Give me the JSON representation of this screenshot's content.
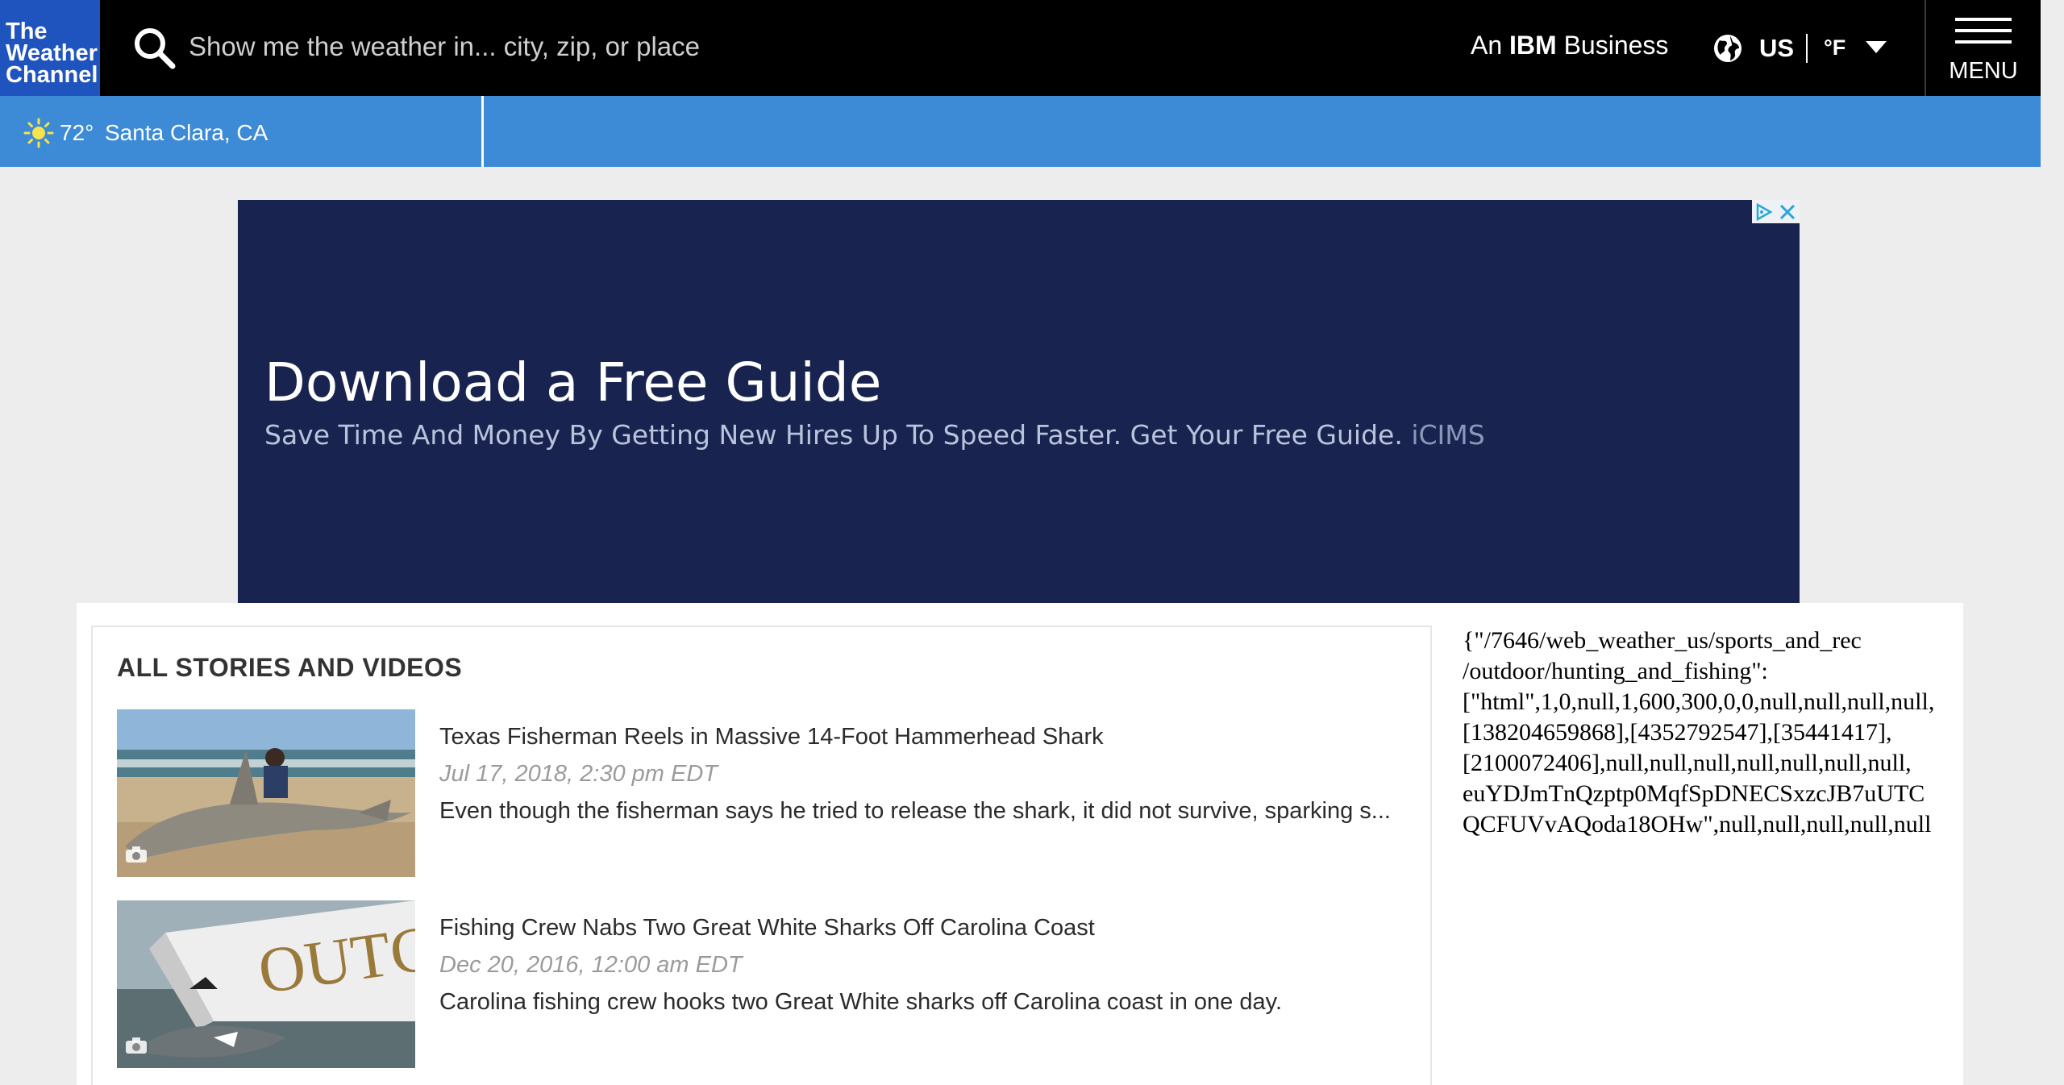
{
  "header": {
    "logo_lines": [
      "The",
      "Weather",
      "Channel"
    ],
    "search_placeholder": "Show me the weather in... city, zip, or place",
    "ibm_prefix": "An",
    "ibm_bold": "IBM",
    "ibm_suffix": "Business",
    "locale": "US",
    "unit": "°F",
    "menu_label": "MENU"
  },
  "location_bar": {
    "temperature": "72°",
    "city": "Santa Clara, CA"
  },
  "ad": {
    "title": "Download a Free Guide",
    "subtitle": "Save Time And Money By Getting New Hires Up To Speed Faster. Get Your Free Guide.",
    "brand": "iCIMS"
  },
  "stories": {
    "section_title": "ALL STORIES AND VIDEOS",
    "items": [
      {
        "title": "Texas Fisherman Reels in Massive 14-Foot Hammerhead Shark",
        "date": "Jul 17, 2018, 2:30 pm EDT",
        "description": "Even though the fisherman says he tried to release the shark, it did not survive, sparking s..."
      },
      {
        "title": "Fishing Crew Nabs Two Great White Sharks Off Carolina Coast",
        "date": "Dec 20, 2016, 12:00 am EDT",
        "description": "Carolina fishing crew hooks two Great White sharks off Carolina coast in one day."
      }
    ]
  },
  "raw_ad_text": {
    "lines": [
      "{\"/7646/web_weather_us/sports_and_rec",
      "/outdoor/hunting_and_fishing\":",
      "[\"html\",1,0,null,1,600,300,0,0,null,null,null,null,",
      "[138204659868],[4352792547],[35441417],",
      "[2100072406],null,null,null,null,null,null,null,",
      "euYDJmTnQzptp0MqfSpDNECSxzcJB7uUTC",
      "QCFUVvAQoda18OHw\",null,null,null,null,null"
    ]
  },
  "colors": {
    "header_bg": "#000000",
    "logo_bg": "#1f54bf",
    "location_bar_bg": "#3d8bd6",
    "ad_bg": "#18244f"
  }
}
